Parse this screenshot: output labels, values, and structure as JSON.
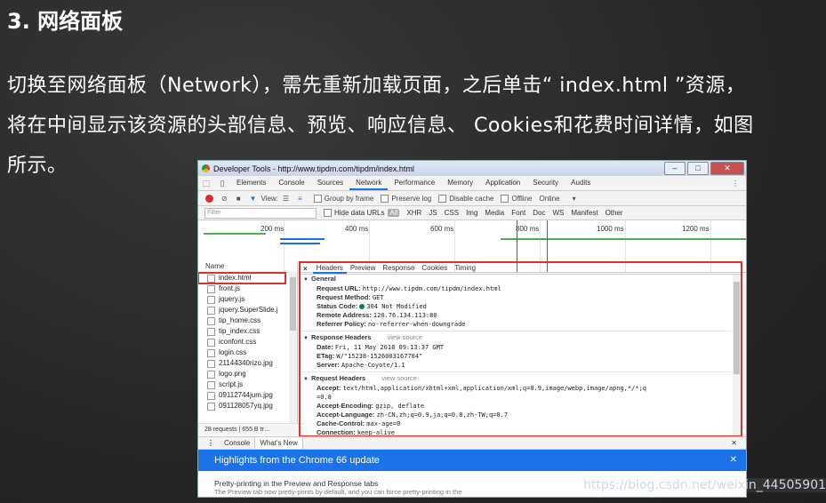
{
  "slide": {
    "title": "3. 网络面板",
    "paragraph_lines": [
      "切换至网络面板（Network），需先重新加载页面，之后单击“ index.html ”资源，",
      "将在中间显示该资源的头部信息、预览、响应信息、 Cookies和花费时间详情，如图",
      "所示。"
    ]
  },
  "devtools": {
    "window_title": "Developer Tools - http://www.tipdm.com/tipdm/index.html",
    "window_controls": [
      "–",
      "□",
      "✕"
    ],
    "tabs": [
      "Elements",
      "Console",
      "Sources",
      "Network",
      "Performance",
      "Memory",
      "Application",
      "Security",
      "Audits"
    ],
    "active_tab": "Network",
    "toolbar": {
      "view_label": "View:",
      "group_by_frame": "Group by frame",
      "preserve_log": "Preserve log",
      "disable_cache": "Disable cache",
      "offline": "Offline",
      "throttle": "Online"
    },
    "filter": {
      "placeholder": "Filter",
      "hide_data_urls": "Hide data URLs",
      "types": [
        "All",
        "XHR",
        "JS",
        "CSS",
        "Img",
        "Media",
        "Font",
        "Doc",
        "WS",
        "Manifest",
        "Other"
      ]
    },
    "timeline_labels": [
      "200 ms",
      "400 ms",
      "600 ms",
      "800 ms",
      "1000 ms",
      "1200 ms"
    ],
    "name_header": "Name",
    "files": [
      "index.html",
      "front.js",
      "jquery.js",
      "jquery.SuperSlide.j",
      "tip_home.css",
      "tip_index.css",
      "iconfont.css",
      "login.css",
      "21144340rizo.jpg",
      "logo.png",
      "script.js",
      "09112744jum.jpg",
      "091128057yq.jpg"
    ],
    "status_bar": "28 requests | 655 B tr…",
    "detail_tabs": [
      "Headers",
      "Preview",
      "Response",
      "Cookies",
      "Timing"
    ],
    "active_detail_tab": "Headers",
    "general": {
      "title": "General",
      "rows": [
        {
          "k": "Request URL:",
          "v": "http://www.tipdm.com/tipdm/index.html"
        },
        {
          "k": "Request Method:",
          "v": "GET"
        },
        {
          "k": "Status Code:",
          "v": "304 Not Modified"
        },
        {
          "k": "Remote Address:",
          "v": "120.76.134.113:80"
        },
        {
          "k": "Referrer Policy:",
          "v": "no-referrer-when-downgrade"
        }
      ]
    },
    "response_headers": {
      "title": "Response Headers",
      "view_source": "view source",
      "rows": [
        {
          "k": "Date:",
          "v": "Fri, 11 May 2018 09:13:37 GMT"
        },
        {
          "k": "ETag:",
          "v": "W/\"15238-1526003167784\""
        },
        {
          "k": "Server:",
          "v": "Apache-Coyote/1.1"
        }
      ]
    },
    "request_headers": {
      "title": "Request Headers",
      "view_source": "view source",
      "rows": [
        {
          "k": "Accept:",
          "v": "text/html,application/xhtml+xml,application/xml;q=0.9,image/webp,image/apng,*/*;q"
        },
        {
          "k": "",
          "v": "=0.8"
        },
        {
          "k": "Accept-Encoding:",
          "v": "gzip, deflate"
        },
        {
          "k": "Accept-Language:",
          "v": "zh-CN,zh;q=0.9,ja;q=0.8,zh-TW;q=0.7"
        },
        {
          "k": "Cache-Control:",
          "v": "max-age=0"
        },
        {
          "k": "Connection:",
          "v": "keep-alive"
        }
      ]
    },
    "drawer": {
      "tabs": [
        "Console",
        "What's New"
      ],
      "active": "What's New",
      "banner": "Highlights from the Chrome 66 update",
      "item_title": "Pretty-printing in the Preview and Response tabs",
      "item_text": "The Preview tab now pretty-prints by default, and you can force pretty-printing in the"
    }
  },
  "watermark": "https://blog.csdn.net/weixin_44505901",
  "colors": {
    "highlight_red": "#e0312b",
    "chrome_blue": "#1a73e8",
    "status_green": "#0b8043"
  }
}
